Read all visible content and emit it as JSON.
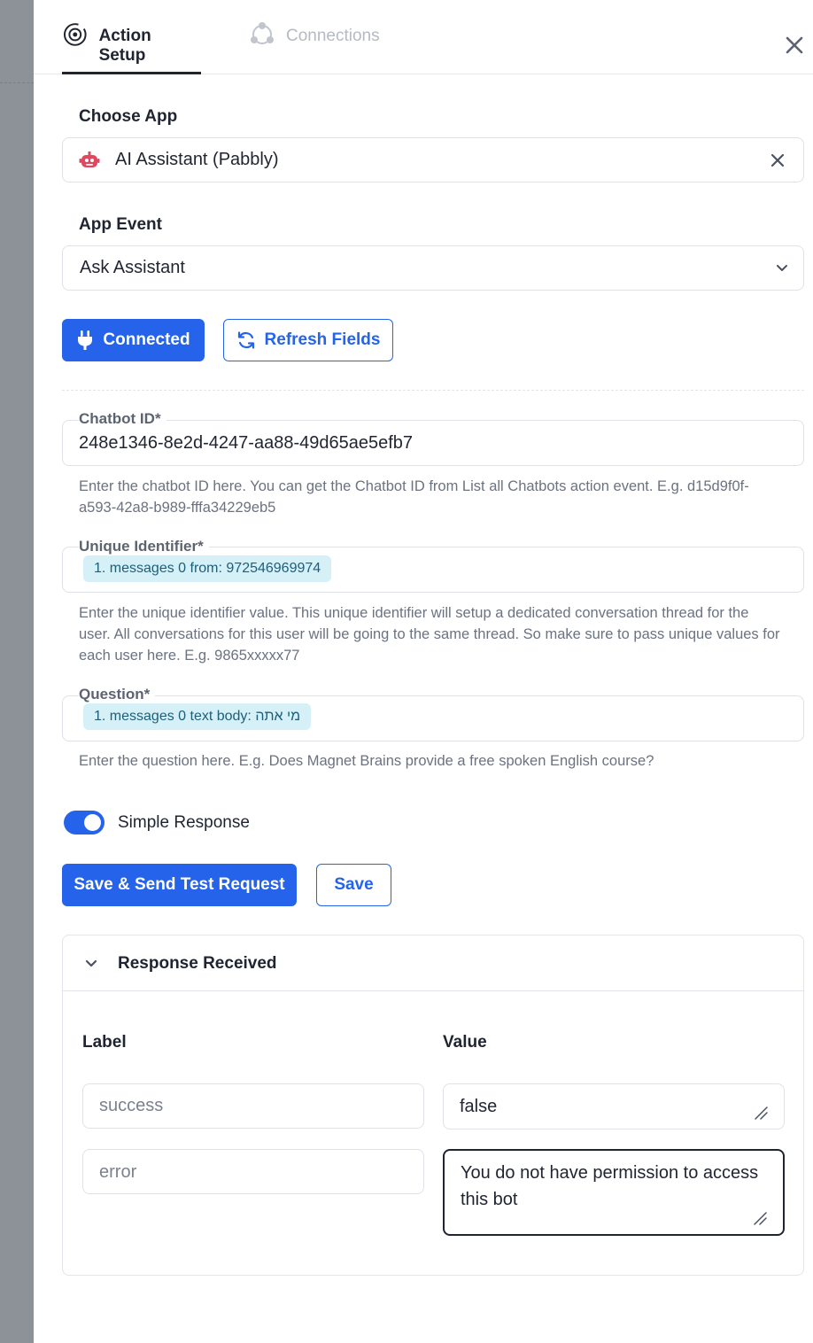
{
  "tabs": {
    "action_setup": "Action Setup",
    "connections": "Connections"
  },
  "choose_app": {
    "label": "Choose App",
    "value": "AI Assistant (Pabbly)"
  },
  "app_event": {
    "label": "App Event",
    "value": "Ask Assistant"
  },
  "buttons": {
    "connected": "Connected",
    "refresh_fields": "Refresh Fields",
    "save_send": "Save & Send Test Request",
    "save": "Save"
  },
  "chatbot_id": {
    "label": "Chatbot ID",
    "required": "*",
    "value": "248e1346-8e2d-4247-aa88-49d65ae5efb7",
    "help_line1": "Enter the chatbot ID here. You can get the Chatbot ID from List all Chatbots action event. E.g. d15d9f0f-",
    "help_line2": "a593-42a8-b989-fffa34229eb5"
  },
  "unique_identifier": {
    "label": "Unique Identifier",
    "required": "*",
    "chip": "1. messages 0 from: 972546969974",
    "help_line1": "Enter the unique identifier value. This unique identifier will setup a dedicated conversation thread for the",
    "help_line2": "user. All conversations for this user will be going to the same thread. So make sure to pass unique values for",
    "help_line3": "each user here. E.g. 9865xxxxx77"
  },
  "question": {
    "label": "Question",
    "required": "*",
    "chip": "1. messages 0 text body: מי אתה",
    "help": "Enter the question here. E.g. Does Magnet Brains provide a free spoken English course?"
  },
  "simple_response": {
    "label": "Simple Response",
    "enabled": true
  },
  "response": {
    "title": "Response Received",
    "col_label": "Label",
    "col_value": "Value",
    "rows": [
      {
        "label": "success",
        "value": "false"
      },
      {
        "label": "error",
        "value_line1": "You do not have permission to access",
        "value_line2": "this bot"
      }
    ]
  },
  "colors": {
    "primary": "#2563eb",
    "chip_bg": "#d5f0f7",
    "app_icon": "#e0485f"
  }
}
